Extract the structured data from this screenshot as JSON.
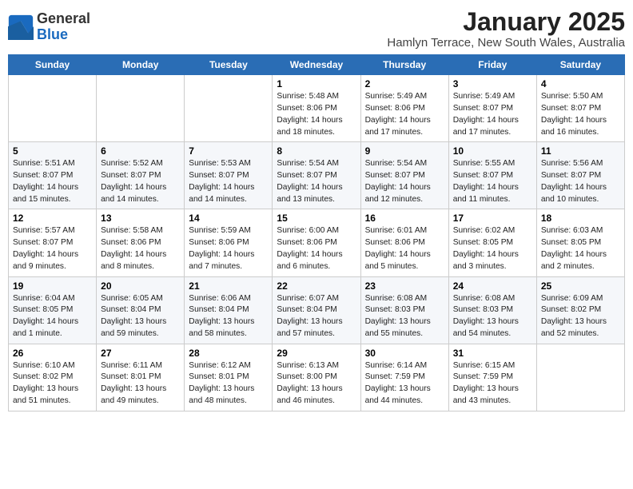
{
  "header": {
    "logo_line1": "General",
    "logo_line2": "Blue",
    "title": "January 2025",
    "subtitle": "Hamlyn Terrace, New South Wales, Australia"
  },
  "weekdays": [
    "Sunday",
    "Monday",
    "Tuesday",
    "Wednesday",
    "Thursday",
    "Friday",
    "Saturday"
  ],
  "weeks": [
    [
      {
        "day": "",
        "info": ""
      },
      {
        "day": "",
        "info": ""
      },
      {
        "day": "",
        "info": ""
      },
      {
        "day": "1",
        "info": "Sunrise: 5:48 AM\nSunset: 8:06 PM\nDaylight: 14 hours\nand 18 minutes."
      },
      {
        "day": "2",
        "info": "Sunrise: 5:49 AM\nSunset: 8:06 PM\nDaylight: 14 hours\nand 17 minutes."
      },
      {
        "day": "3",
        "info": "Sunrise: 5:49 AM\nSunset: 8:07 PM\nDaylight: 14 hours\nand 17 minutes."
      },
      {
        "day": "4",
        "info": "Sunrise: 5:50 AM\nSunset: 8:07 PM\nDaylight: 14 hours\nand 16 minutes."
      }
    ],
    [
      {
        "day": "5",
        "info": "Sunrise: 5:51 AM\nSunset: 8:07 PM\nDaylight: 14 hours\nand 15 minutes."
      },
      {
        "day": "6",
        "info": "Sunrise: 5:52 AM\nSunset: 8:07 PM\nDaylight: 14 hours\nand 14 minutes."
      },
      {
        "day": "7",
        "info": "Sunrise: 5:53 AM\nSunset: 8:07 PM\nDaylight: 14 hours\nand 14 minutes."
      },
      {
        "day": "8",
        "info": "Sunrise: 5:54 AM\nSunset: 8:07 PM\nDaylight: 14 hours\nand 13 minutes."
      },
      {
        "day": "9",
        "info": "Sunrise: 5:54 AM\nSunset: 8:07 PM\nDaylight: 14 hours\nand 12 minutes."
      },
      {
        "day": "10",
        "info": "Sunrise: 5:55 AM\nSunset: 8:07 PM\nDaylight: 14 hours\nand 11 minutes."
      },
      {
        "day": "11",
        "info": "Sunrise: 5:56 AM\nSunset: 8:07 PM\nDaylight: 14 hours\nand 10 minutes."
      }
    ],
    [
      {
        "day": "12",
        "info": "Sunrise: 5:57 AM\nSunset: 8:07 PM\nDaylight: 14 hours\nand 9 minutes."
      },
      {
        "day": "13",
        "info": "Sunrise: 5:58 AM\nSunset: 8:06 PM\nDaylight: 14 hours\nand 8 minutes."
      },
      {
        "day": "14",
        "info": "Sunrise: 5:59 AM\nSunset: 8:06 PM\nDaylight: 14 hours\nand 7 minutes."
      },
      {
        "day": "15",
        "info": "Sunrise: 6:00 AM\nSunset: 8:06 PM\nDaylight: 14 hours\nand 6 minutes."
      },
      {
        "day": "16",
        "info": "Sunrise: 6:01 AM\nSunset: 8:06 PM\nDaylight: 14 hours\nand 5 minutes."
      },
      {
        "day": "17",
        "info": "Sunrise: 6:02 AM\nSunset: 8:05 PM\nDaylight: 14 hours\nand 3 minutes."
      },
      {
        "day": "18",
        "info": "Sunrise: 6:03 AM\nSunset: 8:05 PM\nDaylight: 14 hours\nand 2 minutes."
      }
    ],
    [
      {
        "day": "19",
        "info": "Sunrise: 6:04 AM\nSunset: 8:05 PM\nDaylight: 14 hours\nand 1 minute."
      },
      {
        "day": "20",
        "info": "Sunrise: 6:05 AM\nSunset: 8:04 PM\nDaylight: 13 hours\nand 59 minutes."
      },
      {
        "day": "21",
        "info": "Sunrise: 6:06 AM\nSunset: 8:04 PM\nDaylight: 13 hours\nand 58 minutes."
      },
      {
        "day": "22",
        "info": "Sunrise: 6:07 AM\nSunset: 8:04 PM\nDaylight: 13 hours\nand 57 minutes."
      },
      {
        "day": "23",
        "info": "Sunrise: 6:08 AM\nSunset: 8:03 PM\nDaylight: 13 hours\nand 55 minutes."
      },
      {
        "day": "24",
        "info": "Sunrise: 6:08 AM\nSunset: 8:03 PM\nDaylight: 13 hours\nand 54 minutes."
      },
      {
        "day": "25",
        "info": "Sunrise: 6:09 AM\nSunset: 8:02 PM\nDaylight: 13 hours\nand 52 minutes."
      }
    ],
    [
      {
        "day": "26",
        "info": "Sunrise: 6:10 AM\nSunset: 8:02 PM\nDaylight: 13 hours\nand 51 minutes."
      },
      {
        "day": "27",
        "info": "Sunrise: 6:11 AM\nSunset: 8:01 PM\nDaylight: 13 hours\nand 49 minutes."
      },
      {
        "day": "28",
        "info": "Sunrise: 6:12 AM\nSunset: 8:01 PM\nDaylight: 13 hours\nand 48 minutes."
      },
      {
        "day": "29",
        "info": "Sunrise: 6:13 AM\nSunset: 8:00 PM\nDaylight: 13 hours\nand 46 minutes."
      },
      {
        "day": "30",
        "info": "Sunrise: 6:14 AM\nSunset: 7:59 PM\nDaylight: 13 hours\nand 44 minutes."
      },
      {
        "day": "31",
        "info": "Sunrise: 6:15 AM\nSunset: 7:59 PM\nDaylight: 13 hours\nand 43 minutes."
      },
      {
        "day": "",
        "info": ""
      }
    ]
  ]
}
